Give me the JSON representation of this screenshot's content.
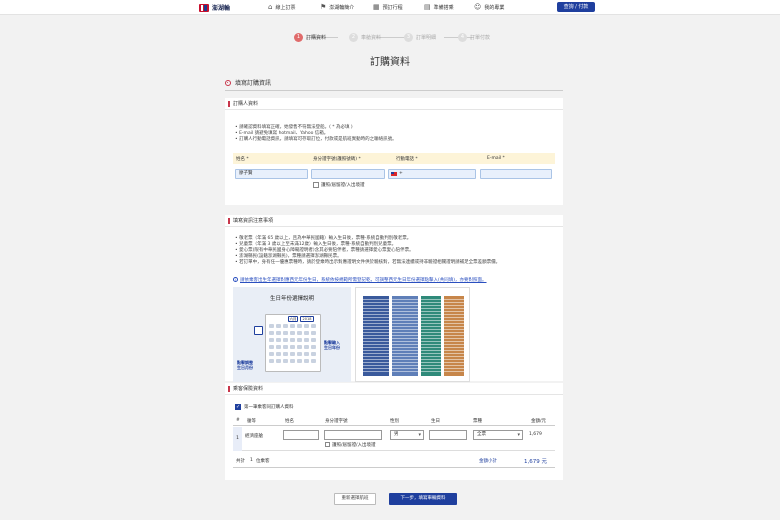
{
  "nav": {
    "logo": "澎湖輪",
    "items": [
      {
        "label": "線上訂票",
        "icon": "ticket-icon"
      },
      {
        "label": "澎湖輪簡介",
        "icon": "flag-icon"
      },
      {
        "label": "預訂行程",
        "icon": "calendar-icon"
      },
      {
        "label": "準備搭乘",
        "icon": "luggage-icon"
      },
      {
        "label": "我的專業",
        "icon": "user-icon"
      }
    ],
    "query_button": "查詢 / 付款"
  },
  "steps": [
    {
      "num": "1",
      "label": "訂購資料",
      "active": true
    },
    {
      "num": "2",
      "label": "車艙資料",
      "active": false
    },
    {
      "num": "3",
      "label": "訂單明細",
      "active": false
    },
    {
      "num": "4",
      "label": "訂單付款",
      "active": false
    }
  ],
  "page_title": "訂購資料",
  "section_title": "填寫訂購資訊",
  "buyer": {
    "title": "訂購人資料",
    "notes": [
      "請確認資料填寫正確，始發售不符無法登船。( * 為必填 )",
      "E-mail 請避免填寫 hotmail、Yahoo 信箱。",
      "訂購人行動電話資訊，請填寫可存取訂位，付款或是航班異動時的之聯絡訊號。"
    ],
    "headers": {
      "name": "姓名 *",
      "id": "身分證字號(護照號碼) *",
      "phone": "行動電話 *",
      "email": "E-mail *"
    },
    "name_value": "廖子賢",
    "phone_prefix": "+",
    "passport_label": "護照/居留證/入出境證"
  },
  "notice": {
    "title": "填寫資訊注意事項",
    "notes": [
      "敬老票（年滿 65 歲以上，且為中華民國籍）輸入生日後，票種-系統自動判別敬老票。",
      "兒童票（年滿 3 歲以上至未滿12歲）輸入生日後，票種-系統自動判別兒童票。",
      "愛心票(限有中華民國身心障礙證明者)含其必要陪伴者，票種請選擇愛心票愛心陪伴票。",
      "澎湖縣民(設籍澎湖縣民)，票種請選擇澎湖縣民票。",
      "若訂單中，身有任一優惠票種時，請於登乘時出示對應證明文件供於驗核對，若無法連續或持非驗證相關證明請補足全票差額票價。"
    ],
    "link": "請依乘客出生年選擇對應西元年份生日，系統依按規範所需登記乾，可調整西元生日年份選擇點擊入(共同填)，亦要對照面。",
    "illus_title": "生日年份選擇說明",
    "illus_left": "點擊調整\n生日月份",
    "illus_right": "點擊輸入\n生日年份",
    "picker_month": "六月",
    "picker_year": "2018"
  },
  "insurance": {
    "title": "乘客保險資料",
    "same_as_buyer": "第一筆乘客同訂購人資料",
    "headers": [
      "#",
      "艙等",
      "姓名",
      "身分證字號",
      "性別",
      "生日",
      "票種",
      "金額/元"
    ],
    "row": {
      "index": "1",
      "class": "經濟座艙",
      "gender": "男",
      "ticket": "全票",
      "amount": "1,679"
    },
    "passport_label": "護照/居留證/入出境證",
    "count_label": "共計",
    "count_value": "1",
    "count_unit": "位乘客",
    "subtotal_label": "金額小計",
    "subtotal_value": "1,679 元"
  },
  "buttons": {
    "back": "重新選擇航班",
    "next": "下一步，填寫車輛資料"
  },
  "colors": {
    "brand_blue": "#1f3f9e",
    "accent_red": "#c8364b",
    "form_head_bg": "#fdf4d8"
  }
}
